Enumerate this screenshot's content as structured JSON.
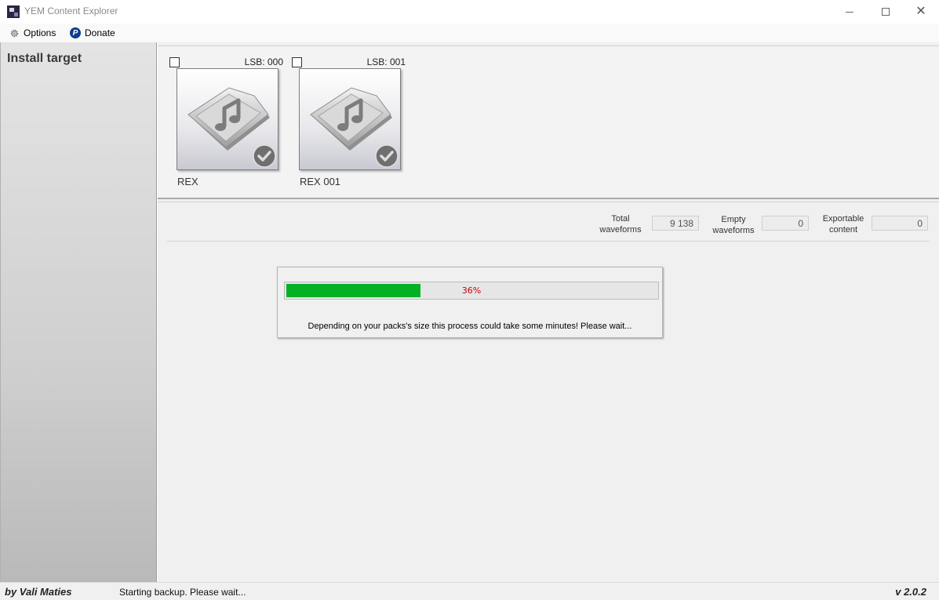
{
  "window": {
    "title": "YEM Content Explorer",
    "controls": {
      "minimize": "minimize",
      "maximize": "maximize",
      "close": "close"
    }
  },
  "menu": {
    "options_label": "Options",
    "options_icon": "gear-icon",
    "donate_label": "Donate",
    "donate_icon": "paypal-icon"
  },
  "sidebar": {
    "title": "Install target"
  },
  "tiles": [
    {
      "name": "REX",
      "lsb": "LSB: 000",
      "checked": false,
      "icon": "music-folder-icon",
      "badge": "checkmark-icon"
    },
    {
      "name": "REX 001",
      "lsb": "LSB: 001",
      "checked": false,
      "icon": "music-folder-icon",
      "badge": "checkmark-icon"
    }
  ],
  "stats": {
    "total_waveforms_label_line1": "Total",
    "total_waveforms_label_line2": "waveforms",
    "total_waveforms_value": "9 138",
    "empty_waveforms_label_line1": "Empty",
    "empty_waveforms_label_line2": "waveforms",
    "empty_waveforms_value": "0",
    "exportable_content_label_line1": "Exportable",
    "exportable_content_label_line2": "content",
    "exportable_content_value": "0"
  },
  "progress": {
    "percent": 36,
    "percent_text": "36%",
    "fill_color": "#06b025",
    "text_color": "#cc0000",
    "message": "Depending on your packs's size this process could take some minutes! Please wait..."
  },
  "status": {
    "author": "by Vali Maties",
    "text": "Starting backup. Please wait...",
    "version": "v 2.0.2"
  }
}
